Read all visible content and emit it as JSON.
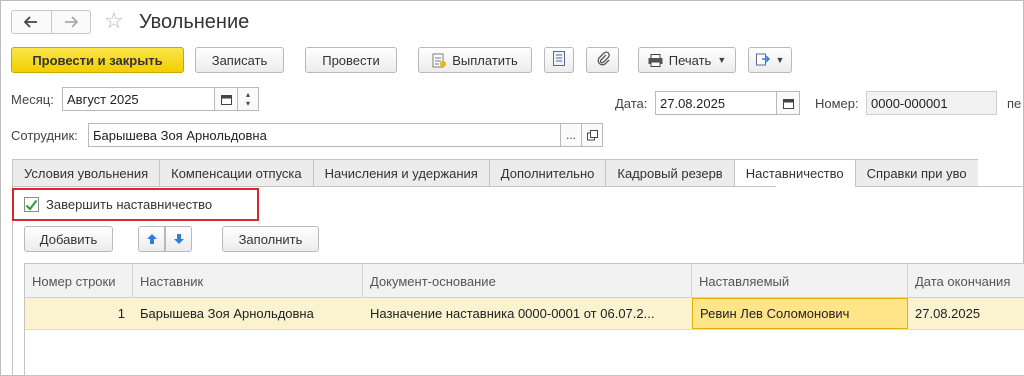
{
  "window": {
    "title": "Увольнение"
  },
  "toolbar": {
    "post_and_close": "Провести и закрыть",
    "save": "Записать",
    "post": "Провести",
    "pay": "Выплатить",
    "print": "Печать"
  },
  "header": {
    "month_label": "Месяц:",
    "month_value": "Август 2025",
    "date_label": "Дата:",
    "date_value": "27.08.2025",
    "number_label": "Номер:",
    "number_value": "0000-000001",
    "number_tail": "пе",
    "employee_label": "Сотрудник:",
    "employee_value": "Барышева Зоя Арнольдовна"
  },
  "tabs": [
    {
      "label": "Условия увольнения",
      "active": false
    },
    {
      "label": "Компенсации отпуска",
      "active": false
    },
    {
      "label": "Начисления и удержания",
      "active": false
    },
    {
      "label": "Дополнительно",
      "active": false
    },
    {
      "label": "Кадровый резерв",
      "active": false
    },
    {
      "label": "Наставничество",
      "active": true
    },
    {
      "label": "Справки при уво",
      "active": false
    }
  ],
  "mentorship": {
    "finish_checkbox_label": "Завершить наставничество",
    "finish_checked": true,
    "add_button": "Добавить",
    "fill_button": "Заполнить"
  },
  "table": {
    "columns": [
      "Номер строки",
      "Наставник",
      "Документ-основание",
      "Наставляемый",
      "Дата окончания"
    ],
    "rows": [
      {
        "row_number": "1",
        "mentor": "Барышева Зоя Арнольдовна",
        "basis_document": "Назначение наставника 0000-0001 от 06.07.2...",
        "mentee": "Ревин Лев Соломонович",
        "end_date": "27.08.2025"
      }
    ]
  },
  "colors": {
    "primary_button": "#f2cf00",
    "highlight_border": "#d7262e",
    "selected_row": "#fbf3cf",
    "selected_cell": "#ffe48a",
    "check_green": "#3a9a3a",
    "arrow_blue": "#2f7fd6"
  },
  "icons": [
    "back-arrow-icon",
    "forward-arrow-icon",
    "star-icon",
    "document-pay-icon",
    "list-icon",
    "paperclip-icon",
    "printer-icon",
    "export-icon",
    "calendar-icon",
    "spin-icon",
    "open-form-icon",
    "arrow-up-icon",
    "arrow-down-icon",
    "checkmark-icon"
  ]
}
